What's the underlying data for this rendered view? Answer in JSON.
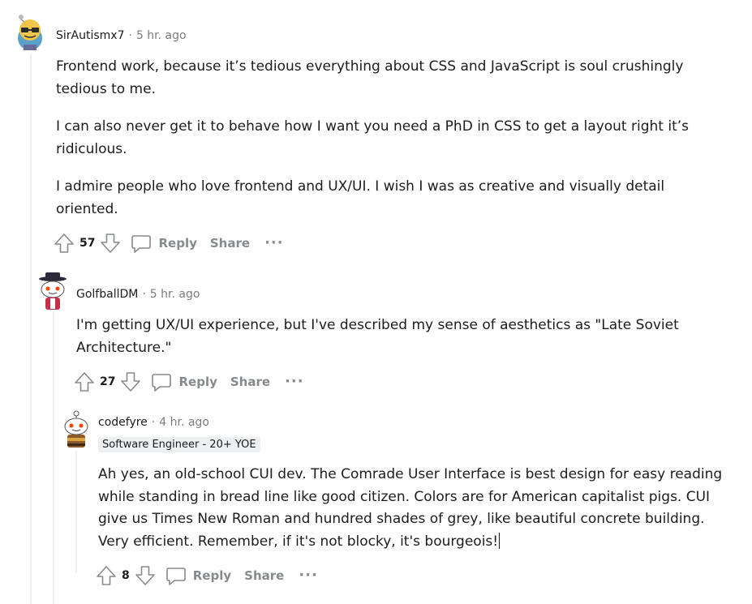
{
  "comments": [
    {
      "author": "SirAutismx7",
      "time": "5 hr. ago",
      "paragraphs": [
        "Frontend work, because it’s tedious everything about CSS and JavaScript is soul crushingly tedious to me.",
        "I can also never get it to behave how I want you need a PhD in CSS to get a layout right it’s ridiculous.",
        "I admire people who love frontend and UX/UI. I wish I was as creative and visually detail oriented."
      ],
      "score": "57"
    },
    {
      "author": "GolfballDM",
      "time": "5 hr. ago",
      "paragraphs": [
        "I'm getting UX/UI experience, but I've described my sense of aesthetics as \"Late Soviet Architecture.\""
      ],
      "score": "27"
    },
    {
      "author": "codefyre",
      "time": "4 hr. ago",
      "flair": "Software Engineer - 20+ YOE",
      "paragraphs": [
        "Ah yes, an old-school CUI dev. The Comrade User Interface is best design for easy reading while standing in bread line like good citizen. Colors are for American capitalist pigs. CUI give us Times New Roman and hundred shades of grey, like beautiful concrete building. Very efficient. Remember, if it's not blocky, it's bourgeois!"
      ],
      "score": "8"
    }
  ],
  "labels": {
    "separator": "·",
    "reply": "Reply",
    "share": "Share",
    "more": "···"
  },
  "colors": {
    "text": "#1c1c1c",
    "muted": "#7c7c7c",
    "action": "#878a8c",
    "thread_line": "#edeff1",
    "flair_bg": "#edeff1"
  }
}
